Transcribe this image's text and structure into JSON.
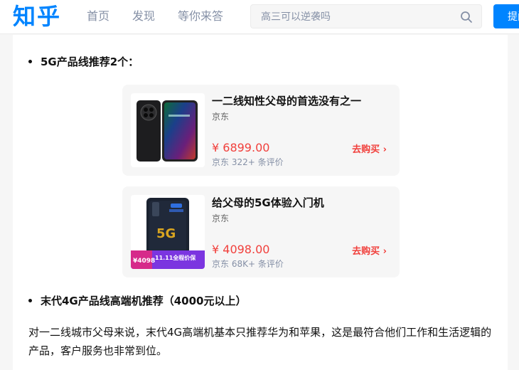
{
  "topbar": {
    "logo": "知乎",
    "nav": [
      "首页",
      "发现",
      "等你来答"
    ],
    "search_placeholder": "高三可以逆袭吗",
    "ask_button": "提问"
  },
  "article": {
    "bullet1": "5G产品线推荐2个：",
    "bullet2": "末代4G产品线高端机推荐（4000元以上）",
    "paragraph": "对一二线城市父母来说，末代4G高端机基本只推荐华为和苹果，这是最符合他们工作和生活逻辑的产品，客户服务也非常到位。",
    "cards": [
      {
        "title": "一二线知性父母的首选没有之一",
        "shop": "京东",
        "price": "¥ 6899.00",
        "meta": "京东 322+ 条评价",
        "buy": "去购买",
        "arrow": "›"
      },
      {
        "title": "给父母的5G体验入门机",
        "shop": "京东",
        "price": "¥ 4098.00",
        "meta": "京东 68K+ 条评价",
        "buy": "去购买",
        "arrow": "›",
        "promo_price": "¥4098",
        "promo_text": "11.11全程价保",
        "phone_label": "5G"
      }
    ]
  }
}
